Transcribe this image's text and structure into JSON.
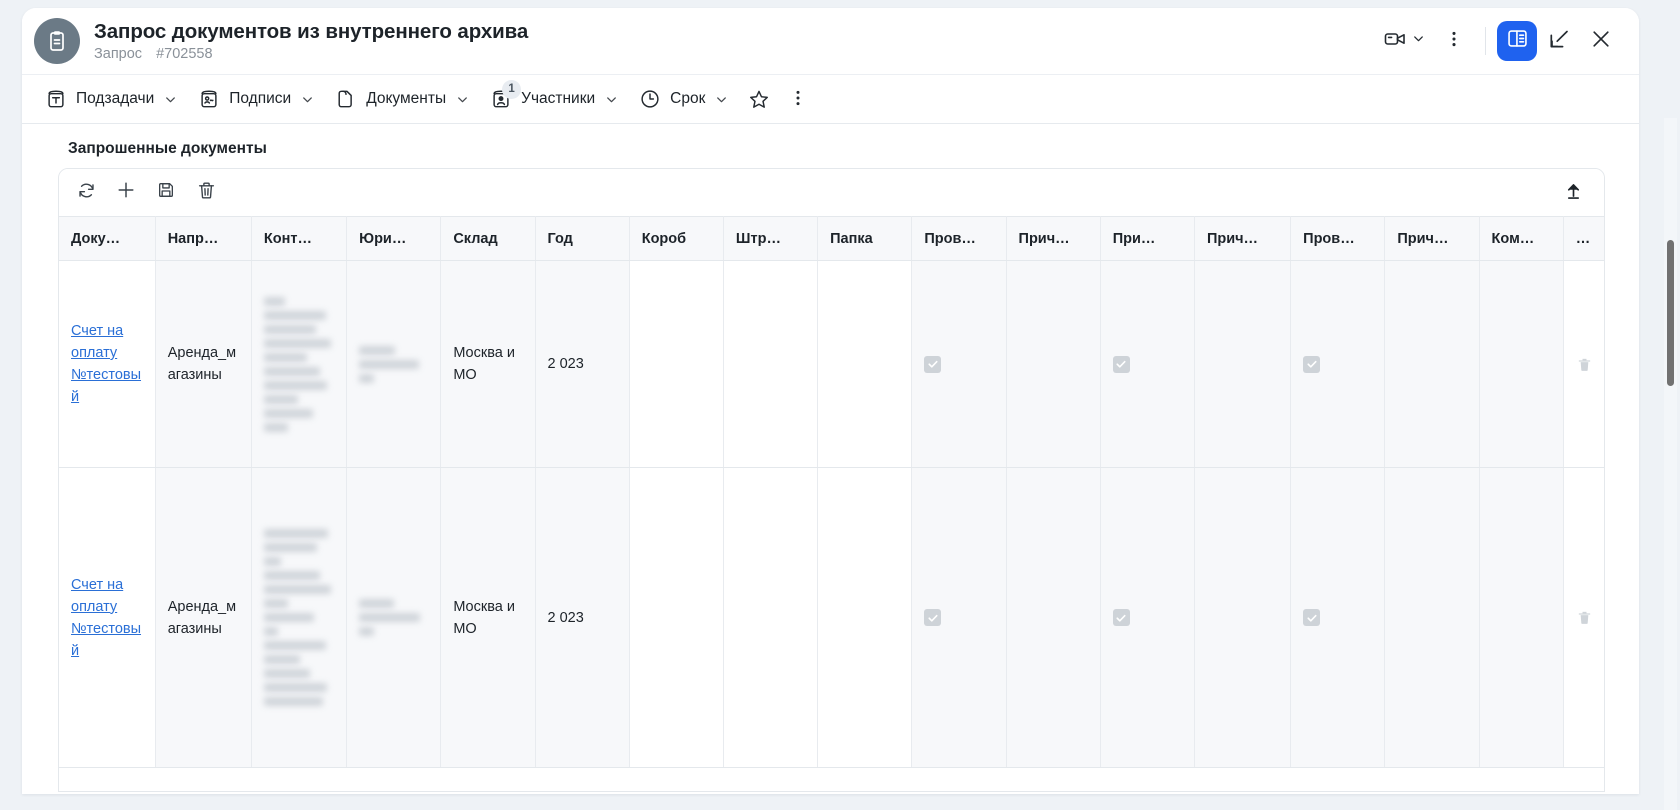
{
  "header": {
    "avatar_icon": "clipboard-icon",
    "title": "Запрос документов из внутреннего архива",
    "subtype": "Запрос",
    "number": "#702558",
    "actions": {
      "video_label": "video-call",
      "kebab_label": "more-options",
      "panel_label": "toggle-side-panel",
      "expand_label": "collapse-panel",
      "close_label": "close"
    },
    "accent_color": "#1f62ef"
  },
  "tabbar": {
    "items": [
      {
        "label": "Подзадачи",
        "icon": "subtasks-icon",
        "chevron": true,
        "badge": ""
      },
      {
        "label": "Подписи",
        "icon": "signature-icon",
        "chevron": true,
        "badge": ""
      },
      {
        "label": "Документы",
        "icon": "documents-icon",
        "chevron": true,
        "badge": ""
      },
      {
        "label": "Участники",
        "icon": "participants-icon",
        "chevron": true,
        "badge": "1"
      },
      {
        "label": "Срок",
        "icon": "clock-icon",
        "chevron": true,
        "badge": ""
      }
    ],
    "star_label": "favorite-star",
    "kebab_label": "tabbar-more"
  },
  "panel": {
    "section_title": "Запрошенные документы",
    "toolbar": {
      "refresh_label": "refresh",
      "add_label": "add-row",
      "save_label": "save",
      "delete_label": "delete",
      "upload_label": "upload"
    }
  },
  "table": {
    "columns": [
      "Доку…",
      "Напр…",
      "Конт…",
      "Юри…",
      "Склад",
      "Год",
      "Короб",
      "Штр…",
      "Папка",
      "Пров…",
      "Прич…",
      "При…",
      "Прич…",
      "Пров…",
      "Прич…",
      "Ком…",
      "…"
    ],
    "rows": [
      {
        "document": "Счет на оплату №тестовый ",
        "direction": "Аренда_магазины",
        "contract": "",
        "legal_entity": "",
        "warehouse": "Москва и МО",
        "year": "2 023",
        "box": "",
        "barcode": "",
        "folder": "",
        "check_1": true,
        "reason_1": "",
        "check_2": true,
        "reason_2": "",
        "check_3": true,
        "reason_3": "",
        "comment": "",
        "delete_label": "delete-row"
      },
      {
        "document": "Счет на оплату №тестовый",
        "direction": "Аренда_магазины",
        "contract": "",
        "legal_entity": "",
        "warehouse": "Москва и МО",
        "year": "2 023",
        "box": "",
        "barcode": "",
        "folder": "",
        "check_1": true,
        "reason_1": "",
        "check_2": true,
        "reason_2": "",
        "check_3": true,
        "reason_3": "",
        "comment": "",
        "delete_label": "delete-row"
      }
    ]
  }
}
